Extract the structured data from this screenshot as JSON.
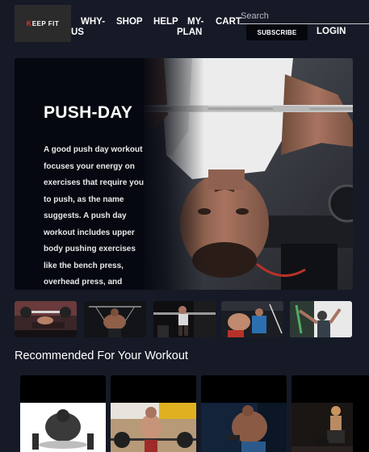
{
  "brand": {
    "logo_text": "EEP FIT",
    "logo_k": "K"
  },
  "nav": {
    "why_us": "WHY-US",
    "shop": "SHOP",
    "help": "HELP",
    "my_plan": "MY-PLAN",
    "cart": "CART"
  },
  "search": {
    "placeholder": "Search",
    "value": ""
  },
  "header_actions": {
    "subscribe_label": "SUBSCRIBE",
    "login_label": "LOGIN"
  },
  "hero": {
    "title": "PUSH-DAY",
    "description": "A good push day workout focuses your energy on exercises that require you to push, as the name suggests. A push day workout includes upper body pushing exercises like the bench press, overhead press, and"
  },
  "thumbnails": [
    {
      "icon": "bench-press-thumbnail"
    },
    {
      "icon": "lat-pulldown-thumbnail"
    },
    {
      "icon": "gym-squat-thumbnail"
    },
    {
      "icon": "dumbbell-workout-thumbnail"
    },
    {
      "icon": "cable-pull-thumbnail"
    }
  ],
  "recommended": {
    "title": "Recommended For Your Workout",
    "cards": [
      {
        "icon": "pushup-image"
      },
      {
        "icon": "barbell-lift-image"
      },
      {
        "icon": "dumbbell-curl-image"
      },
      {
        "icon": "kettlebell-squat-image"
      }
    ]
  },
  "colors": {
    "page_background": "#161a27",
    "hero_background": "#050810",
    "accent_logo": "#e0312b",
    "button_background": "#05070c"
  }
}
